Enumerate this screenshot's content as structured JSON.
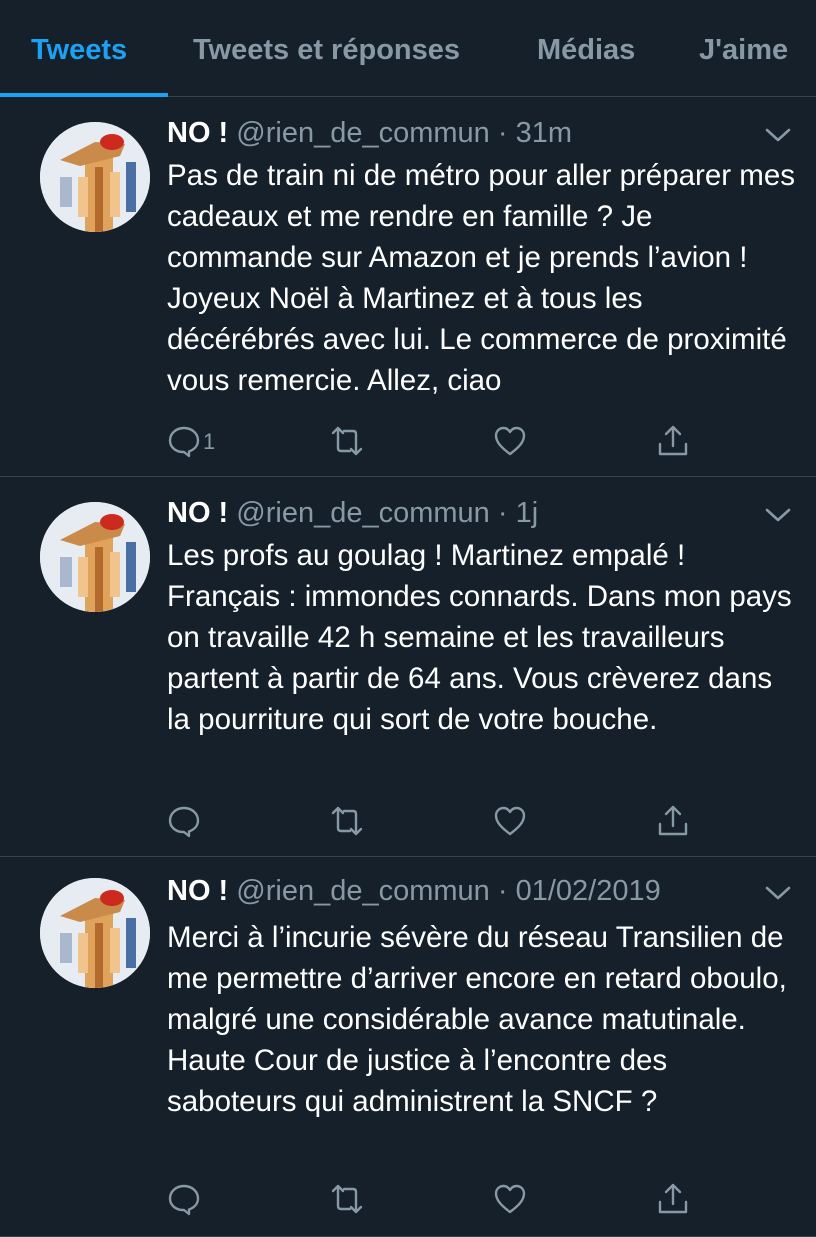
{
  "tabs": [
    {
      "label": "Tweets",
      "active": true
    },
    {
      "label": "Tweets et réponses",
      "active": false
    },
    {
      "label": "Médias",
      "active": false
    },
    {
      "label": "J'aime",
      "active": false
    }
  ],
  "colors": {
    "background": "#15202b",
    "accent": "#1da1f2",
    "muted": "#8899a6",
    "divider": "#38444d"
  },
  "tweets": [
    {
      "name": "NO !",
      "handle": "@rien_de_commun",
      "separator": "·",
      "time": "31m",
      "text": "Pas de train ni de métro pour aller préparer mes cadeaux et me rendre en famille ? Je commande sur Amazon et je prends l’avion ! Joyeux Noël à Martinez et à tous les décérébrés avec lui. Le commerce de proximité vous remercie. Allez, ciao",
      "reply_count": "1",
      "icons": [
        "reply-icon",
        "retweet-icon",
        "like-icon",
        "share-icon"
      ]
    },
    {
      "name": "NO !",
      "handle": "@rien_de_commun",
      "separator": "·",
      "time": "1j",
      "text": "Les profs au goulag ! Martinez empalé  ! Français : immondes connards. Dans mon pays on travaille 42 h semaine et les travailleurs partent à partir de 64 ans. Vous crèverez dans la pourriture qui sort de votre bouche.",
      "reply_count": "",
      "icons": [
        "reply-icon",
        "retweet-icon",
        "like-icon",
        "share-icon"
      ]
    },
    {
      "name": "NO !",
      "handle": "@rien_de_commun",
      "separator": "·",
      "time": "01/02/2019",
      "text": "Merci à l’incurie sévère du réseau Transilien de me permettre d’arriver encore en retard oboulo, malgré une considérable avance matutinale. Haute Cour de justice à l’encontre des saboteurs qui administrent la SNCF ?",
      "reply_count": "",
      "icons": [
        "reply-icon",
        "retweet-icon",
        "like-icon",
        "share-icon"
      ]
    }
  ]
}
